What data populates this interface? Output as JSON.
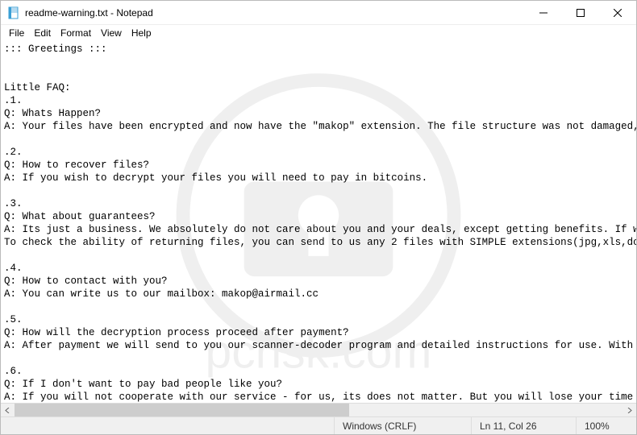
{
  "title": "readme-warning.txt - Notepad",
  "menu": [
    "File",
    "Edit",
    "Format",
    "View",
    "Help"
  ],
  "content_lines": [
    "::: Greetings :::",
    "",
    "",
    "Little FAQ:",
    ".1.",
    "Q: Whats Happen?",
    "A: Your files have been encrypted and now have the \"makop\" extension. The file structure was not damaged, we",
    "",
    ".2.",
    "Q: How to recover files?",
    "A: If you wish to decrypt your files you will need to pay in bitcoins.",
    "",
    ".3.",
    "Q: What about guarantees?",
    "A: Its just a business. We absolutely do not care about you and your deals, except getting benefits. If we d",
    "To check the ability of returning files, you can send to us any 2 files with SIMPLE extensions(jpg,xls,doc, ",
    "",
    ".4.",
    "Q: How to contact with you?",
    "A: You can write us to our mailbox: makop@airmail.cc",
    "",
    ".5.",
    "Q: How will the decryption process proceed after payment?",
    "A: After payment we will send to you our scanner-decoder program and detailed instructions for use. With thi",
    "",
    ".6.",
    "Q: If I don't want to pay bad people like you?",
    "A: If you will not cooperate with our service - for us, its does not matter. But you will lose your time and"
  ],
  "status": {
    "encoding": "Windows (CRLF)",
    "position": "Ln 11, Col 26",
    "zoom": "100%"
  }
}
